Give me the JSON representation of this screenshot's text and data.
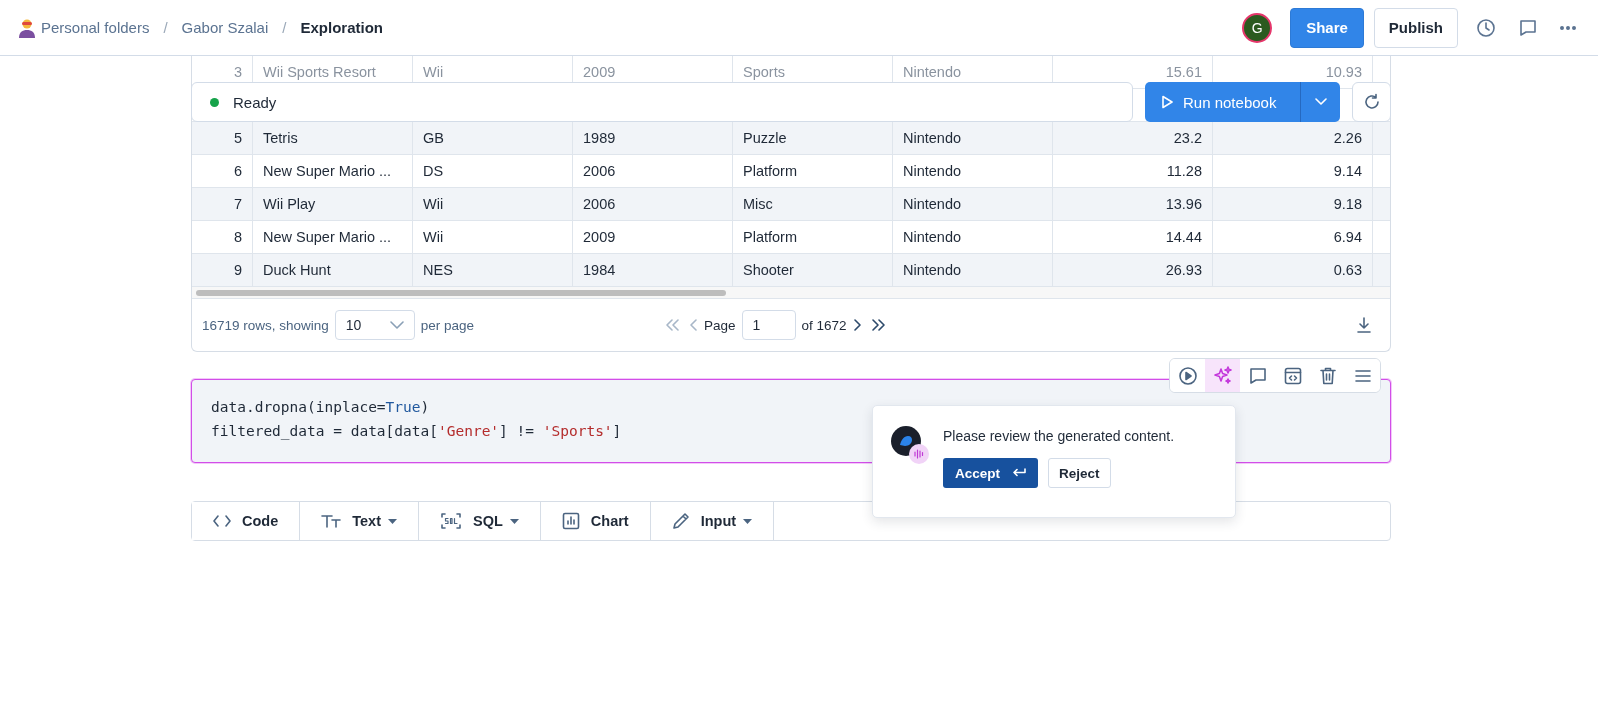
{
  "breadcrumb_separator": "/",
  "breadcrumbs": [
    {
      "label": "Personal folders",
      "current": false
    },
    {
      "label": "Gabor Szalai",
      "current": false
    },
    {
      "label": "Exploration",
      "current": true
    }
  ],
  "header": {
    "avatar": "G",
    "share": "Share",
    "publish": "Publish"
  },
  "run_bar": {
    "status": "Ready",
    "run_label": "Run notebook"
  },
  "table": {
    "rows": [
      {
        "index": "3",
        "faded": true,
        "cells": [
          "Wii Sports Resort",
          "Wii",
          "2009",
          "Sports",
          "Nintendo",
          "15.61",
          "10.93"
        ]
      },
      {
        "index": "5",
        "faded": false,
        "cells": [
          "Tetris",
          "GB",
          "1989",
          "Puzzle",
          "Nintendo",
          "23.2",
          "2.26"
        ]
      },
      {
        "index": "6",
        "faded": false,
        "cells": [
          "New Super Mario ...",
          "DS",
          "2006",
          "Platform",
          "Nintendo",
          "11.28",
          "9.14"
        ]
      },
      {
        "index": "7",
        "faded": false,
        "cells": [
          "Wii Play",
          "Wii",
          "2006",
          "Misc",
          "Nintendo",
          "13.96",
          "9.18"
        ]
      },
      {
        "index": "8",
        "faded": false,
        "cells": [
          "New Super Mario ...",
          "Wii",
          "2009",
          "Platform",
          "Nintendo",
          "14.44",
          "6.94"
        ]
      },
      {
        "index": "9",
        "faded": false,
        "cells": [
          "Duck Hunt",
          "NES",
          "1984",
          "Shooter",
          "Nintendo",
          "26.93",
          "0.63"
        ]
      }
    ],
    "footer": {
      "rows_text": "16719 rows, showing",
      "page_size": "10",
      "per_page": "per page",
      "page_label": "Page",
      "page": "1",
      "page_count": "of 1672"
    }
  },
  "code_cell": {
    "selected": true,
    "lines": [
      [
        {
          "kind": "plain",
          "text": "data.dropna(inplace="
        },
        {
          "kind": "keyword",
          "text": "True"
        },
        {
          "kind": "plain",
          "text": ")"
        }
      ],
      [
        {
          "kind": "plain",
          "text": "filtered_data = data[data["
        },
        {
          "kind": "string",
          "text": "'Genre'"
        },
        {
          "kind": "plain",
          "text": "] != "
        },
        {
          "kind": "string",
          "text": "'Sports'"
        },
        {
          "kind": "plain",
          "text": "]"
        }
      ]
    ],
    "toolbar": [
      {
        "kind": "run",
        "selected": false
      },
      {
        "kind": "ai",
        "selected": true
      },
      {
        "kind": "comment",
        "selected": false
      },
      {
        "kind": "embed",
        "selected": false
      },
      {
        "kind": "delete",
        "selected": false
      },
      {
        "kind": "menu",
        "selected": false
      }
    ],
    "review": {
      "message": "Please review the generated content.",
      "accept": "Accept",
      "reject": "Reject"
    }
  },
  "add_cell": [
    {
      "kind": "code",
      "label": "Code",
      "dropdown": false
    },
    {
      "kind": "text",
      "label": "Text",
      "dropdown": true
    },
    {
      "kind": "sql",
      "label": "SQL",
      "dropdown": true
    },
    {
      "kind": "chart",
      "label": "Chart",
      "dropdown": false
    },
    {
      "kind": "input",
      "label": "Input",
      "dropdown": true
    }
  ]
}
